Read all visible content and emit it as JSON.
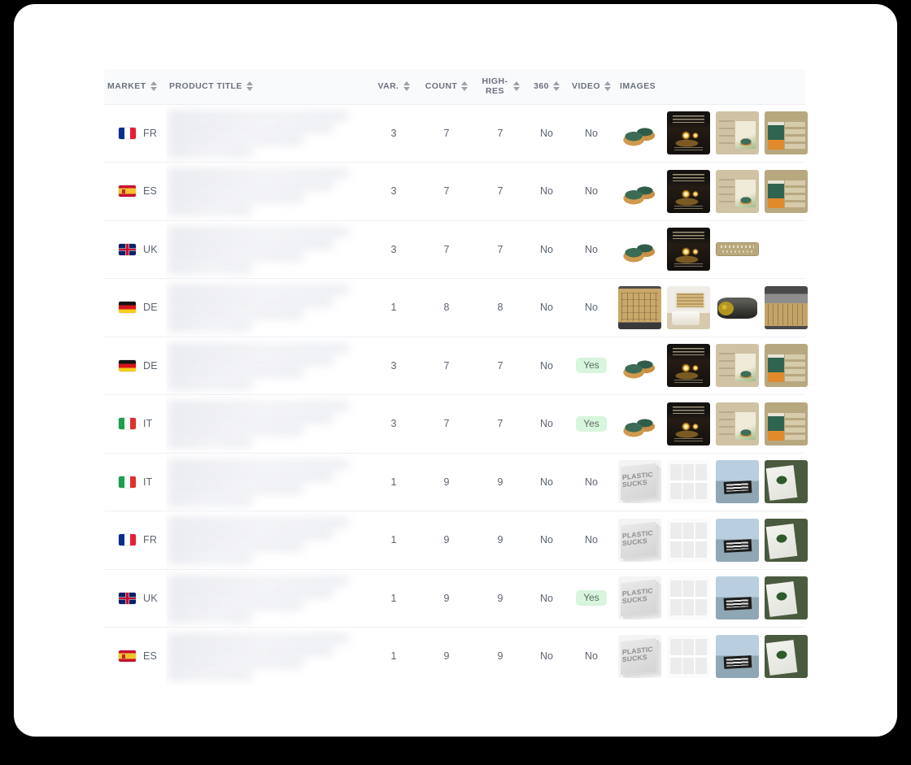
{
  "table": {
    "columns": [
      {
        "key": "market",
        "label": "MARKET",
        "sortable": true,
        "align": "left"
      },
      {
        "key": "title",
        "label": "PRODUCT TITLE",
        "sortable": true,
        "align": "left"
      },
      {
        "key": "var",
        "label": "VAR.",
        "sortable": true,
        "align": "center"
      },
      {
        "key": "count",
        "label": "COUNT",
        "sortable": true,
        "align": "center"
      },
      {
        "key": "hires",
        "label": "HIGH-RES",
        "sortable": true,
        "align": "center"
      },
      {
        "key": "spin360",
        "label": "360",
        "sortable": true,
        "align": "center"
      },
      {
        "key": "video",
        "label": "VIDEO",
        "sortable": true,
        "align": "center"
      },
      {
        "key": "images",
        "label": "IMAGES",
        "sortable": false,
        "align": "left"
      }
    ],
    "rows": [
      {
        "market": "FR",
        "var": "3",
        "count": "7",
        "hires": "7",
        "spin360": "No",
        "video": "No",
        "thumbs": [
          "candle-pair",
          "candle-lit",
          "candle-infocard",
          "candle-featurelist"
        ]
      },
      {
        "market": "ES",
        "var": "3",
        "count": "7",
        "hires": "7",
        "spin360": "No",
        "video": "No",
        "thumbs": [
          "candle-pair",
          "candle-lit",
          "candle-infocard",
          "candle-featurelist"
        ]
      },
      {
        "market": "UK",
        "var": "3",
        "count": "7",
        "hires": "7",
        "spin360": "No",
        "video": "No",
        "thumbs": [
          "candle-pair",
          "candle-lit",
          "gold-banner"
        ]
      },
      {
        "market": "DE",
        "var": "1",
        "count": "8",
        "hires": "8",
        "spin360": "No",
        "video": "No",
        "thumbs": [
          "blind-screen",
          "blind-room",
          "blind-roll",
          "blind-spec"
        ]
      },
      {
        "market": "DE",
        "var": "3",
        "count": "7",
        "hires": "7",
        "spin360": "No",
        "video": "Yes",
        "thumbs": [
          "candle-pair",
          "candle-lit",
          "candle-infocard",
          "candle-featurelist"
        ]
      },
      {
        "market": "IT",
        "var": "3",
        "count": "7",
        "hires": "7",
        "spin360": "No",
        "video": "Yes",
        "thumbs": [
          "candle-pair",
          "candle-lit",
          "candle-infocard",
          "candle-featurelist"
        ]
      },
      {
        "market": "IT",
        "var": "1",
        "count": "9",
        "hires": "9",
        "spin360": "No",
        "video": "No",
        "thumbs": [
          "plastic-sucks",
          "poster-grid",
          "protest-photo",
          "plant-here"
        ]
      },
      {
        "market": "FR",
        "var": "1",
        "count": "9",
        "hires": "9",
        "spin360": "No",
        "video": "No",
        "thumbs": [
          "plastic-sucks",
          "poster-grid",
          "protest-photo",
          "plant-here"
        ]
      },
      {
        "market": "UK",
        "var": "1",
        "count": "9",
        "hires": "9",
        "spin360": "No",
        "video": "Yes",
        "thumbs": [
          "plastic-sucks",
          "poster-grid",
          "protest-photo",
          "plant-here"
        ]
      },
      {
        "market": "ES",
        "var": "1",
        "count": "9",
        "hires": "9",
        "spin360": "No",
        "video": "No",
        "thumbs": [
          "plastic-sucks",
          "poster-grid",
          "protest-photo",
          "plant-here"
        ]
      }
    ]
  },
  "thumbnail_text": {
    "plastic_sucks_line1": "PLASTIC",
    "plastic_sucks_line2": "SUCKS"
  },
  "colors": {
    "page_background": "#000000",
    "card_background": "#ffffff",
    "header_background": "#f9fafb",
    "header_text": "#6b7280",
    "body_text": "#5b6470",
    "row_divider": "#eef0f2",
    "badge_yes_background": "#d8f5dd",
    "badge_yes_text": "#5a6b62"
  }
}
